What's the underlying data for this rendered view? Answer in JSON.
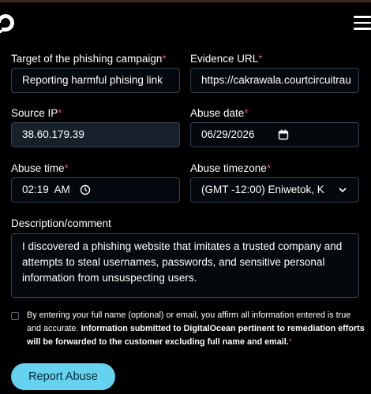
{
  "header": {
    "logo_icon": "digitalocean-logo-icon",
    "menu_icon": "hamburger-menu-icon"
  },
  "form": {
    "target": {
      "label": "Target of the phishing campaign",
      "required": "*",
      "value": "Reporting harmful phising link"
    },
    "evidence_url": {
      "label": "Evidence URL",
      "required": "*",
      "value": "https://cakrawala.courtcircuitrau"
    },
    "source_ip": {
      "label": "Source IP",
      "required": "*",
      "value": "38.60.179.39"
    },
    "abuse_date": {
      "label": "Abuse date",
      "required": "*",
      "value": "06/29/2026"
    },
    "abuse_time": {
      "label": "Abuse time",
      "required": "*",
      "value": "02:19  AM"
    },
    "abuse_timezone": {
      "label": "Abuse timezone",
      "required": "*",
      "value": "(GMT -12:00) Eniwetok, K"
    },
    "description": {
      "label": "Description/comment",
      "value": "I discovered a phishing website that imitates a trusted company and attempts to steal usernames, passwords, and sensitive personal information from unsuspecting users."
    },
    "consent": {
      "text_plain": "By entering your full name (optional) or email, you affirm all information entered is true and accurate. ",
      "text_bold": "Information submitted to DigitalOcean pertinent to remediation efforts will be forwarded to the customer excluding full name and email.",
      "required": "*",
      "checked": false
    },
    "submit_label": "Report Abuse"
  },
  "colors": {
    "background": "#000000",
    "field_border": "#34404e",
    "field_filled": "#18202c",
    "required": "#e0485a",
    "button": "#65d3f0",
    "button_text": "#0a2a36"
  }
}
